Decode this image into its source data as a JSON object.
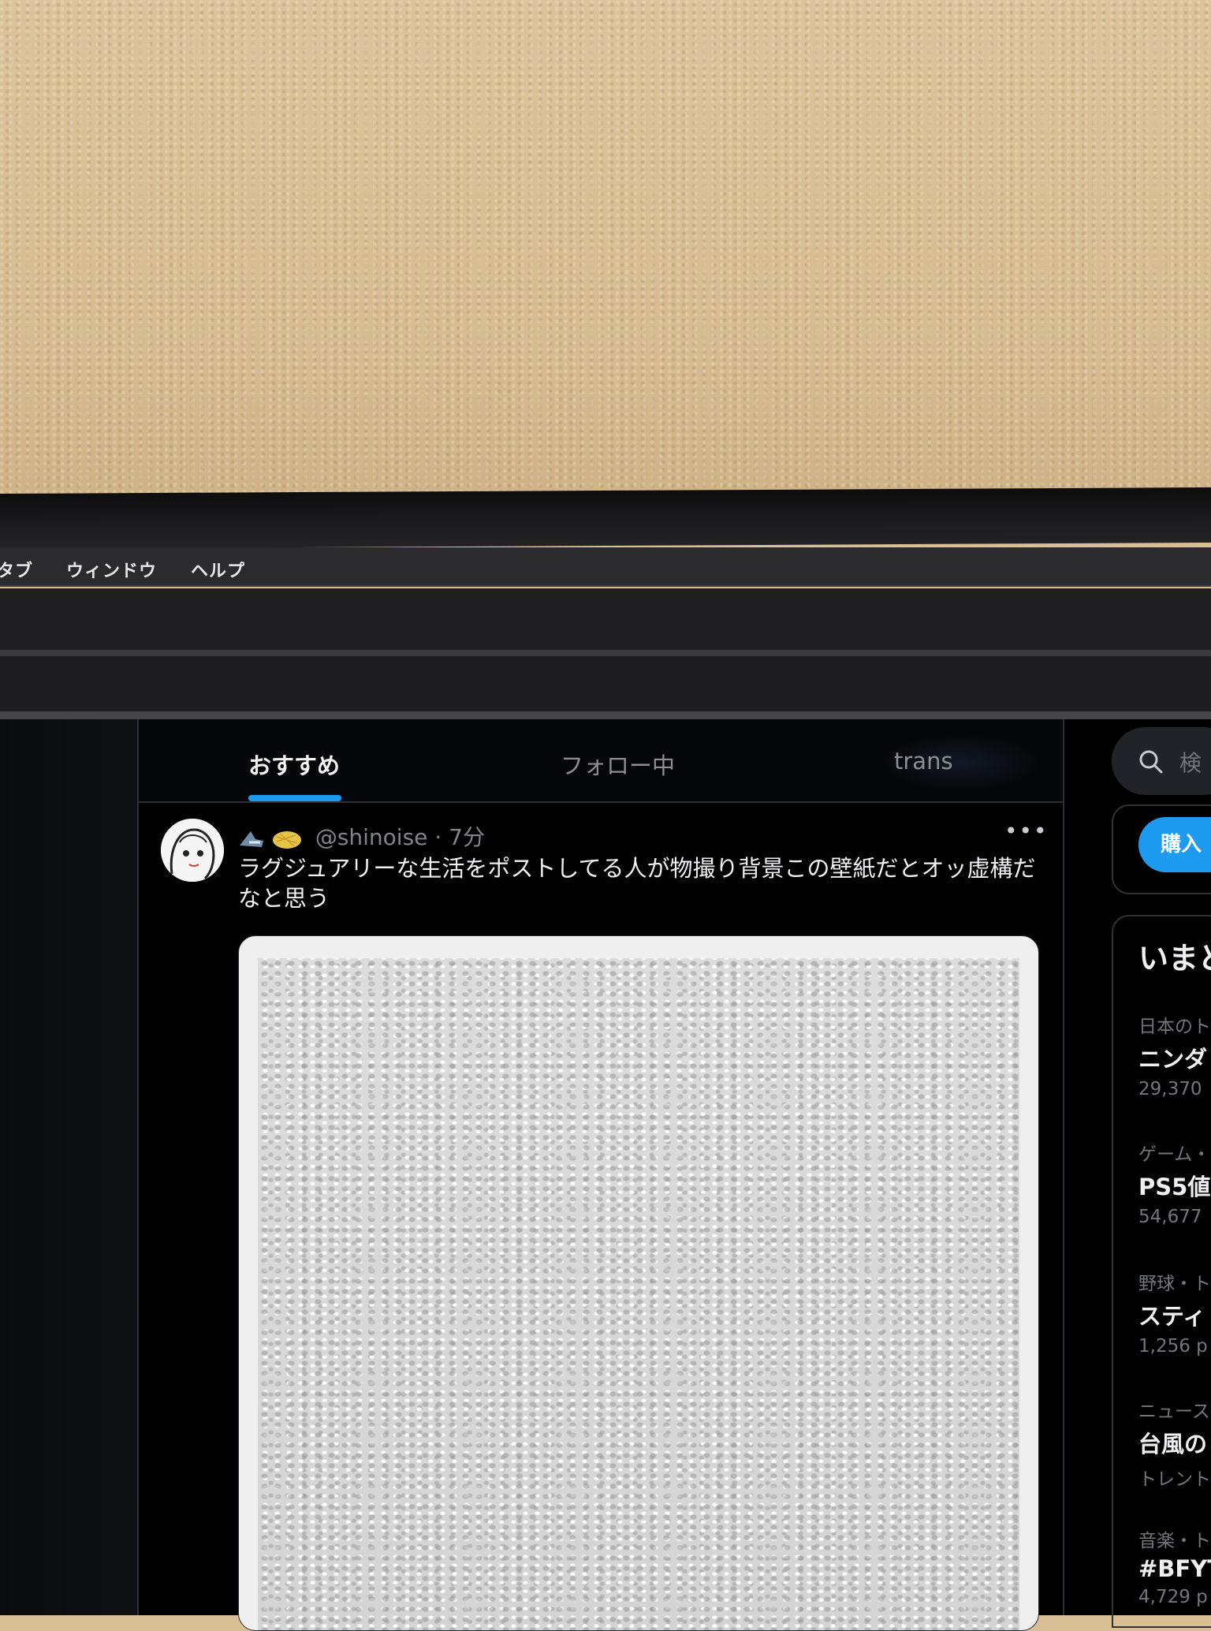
{
  "menubar": {
    "items": [
      "タブ",
      "ウィンドウ",
      "ヘルプ"
    ]
  },
  "tabs": {
    "recommended": "おすすめ",
    "following": "フォロー中",
    "trans": "trans"
  },
  "post": {
    "handle": "@shinoise",
    "separator": "·",
    "time": "7分",
    "more_label": "•••",
    "text": "ラグジュアリーな生活をポストしてる人が物撮り背景この壁紙だとオッ虚構だなと思う"
  },
  "sidebar": {
    "search_placeholder": "検",
    "buy_label": "購入",
    "trends_title": "いまど",
    "trends": [
      {
        "category": "日本のト",
        "name": "ニンダ",
        "count": "29,370"
      },
      {
        "category": "ゲーム・",
        "name": "PS5値",
        "count": "54,677"
      },
      {
        "category": "野球・ト",
        "name": "スティ",
        "count": "1,256 p"
      },
      {
        "category": "ニュース",
        "name": "台風の",
        "count": "トレント"
      },
      {
        "category": "音楽・ト",
        "name": "#BFYT",
        "count": "4,729 p"
      }
    ]
  },
  "colors": {
    "accent": "#1d9bf0",
    "background": "#000000",
    "wall": "#d9bf95"
  }
}
